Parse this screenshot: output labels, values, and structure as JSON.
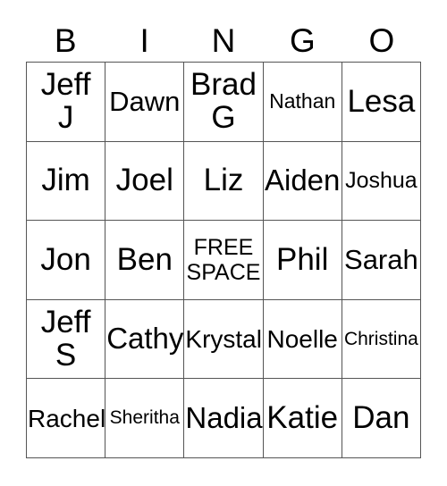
{
  "card": {
    "type": "bingo-card",
    "columns": 5,
    "rows": 5,
    "header": {
      "letters": [
        "B",
        "I",
        "N",
        "G",
        "O"
      ]
    },
    "colors": {
      "background": "#ffffff",
      "text": "#000000",
      "grid_line": "#555555"
    },
    "cells": [
      [
        {
          "text": "Jeff\nJ",
          "size": "fs-xxl",
          "free": false
        },
        {
          "text": "Dawn",
          "size": "fs-lg",
          "free": false
        },
        {
          "text": "Brad\nG",
          "size": "fs-xxl",
          "free": false
        },
        {
          "text": "Nathan",
          "size": "fs-xs",
          "free": false
        },
        {
          "text": "Lesa",
          "size": "fs-xxl",
          "free": false
        }
      ],
      [
        {
          "text": "Jim",
          "size": "fs-xxl",
          "free": false
        },
        {
          "text": "Joel",
          "size": "fs-xxl",
          "free": false
        },
        {
          "text": "Liz",
          "size": "fs-xxl",
          "free": false
        },
        {
          "text": "Aiden",
          "size": "fs-xl",
          "free": false
        },
        {
          "text": "Joshua",
          "size": "fs-sm",
          "free": false
        }
      ],
      [
        {
          "text": "Jon",
          "size": "fs-xxl",
          "free": false
        },
        {
          "text": "Ben",
          "size": "fs-xxl",
          "free": false
        },
        {
          "text": "FREE\nSPACE",
          "size": "fs-free",
          "free": true
        },
        {
          "text": "Phil",
          "size": "fs-xxl",
          "free": false
        },
        {
          "text": "Sarah",
          "size": "fs-lg",
          "free": false
        }
      ],
      [
        {
          "text": "Jeff\nS",
          "size": "fs-xxl",
          "free": false
        },
        {
          "text": "Cathy",
          "size": "fs-xl",
          "free": false
        },
        {
          "text": "Krystal",
          "size": "fs-md",
          "free": false
        },
        {
          "text": "Noelle",
          "size": "fs-md",
          "free": false
        },
        {
          "text": "Christina",
          "size": "fs-xxs",
          "free": false
        }
      ],
      [
        {
          "text": "Rachel",
          "size": "fs-md",
          "free": false
        },
        {
          "text": "Sheritha",
          "size": "fs-xxs",
          "free": false
        },
        {
          "text": "Nadia",
          "size": "fs-xl",
          "free": false
        },
        {
          "text": "Katie",
          "size": "fs-xxl",
          "free": false
        },
        {
          "text": "Dan",
          "size": "fs-xxl",
          "free": false
        }
      ]
    ]
  }
}
